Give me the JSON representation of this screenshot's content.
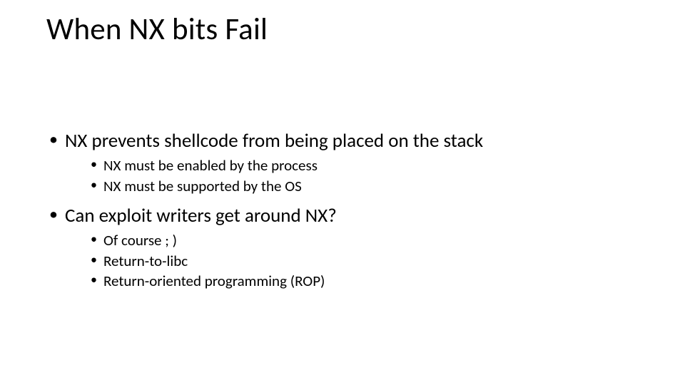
{
  "title": "When NX bits Fail",
  "bullets": [
    {
      "text": "NX prevents shellcode from being placed on the stack",
      "children": [
        {
          "text": "NX must be enabled by the process"
        },
        {
          "text": "NX must be supported by the OS"
        }
      ]
    },
    {
      "text": "Can exploit writers get around NX?",
      "children": [
        {
          "text": "Of course ; )"
        },
        {
          "text": "Return-to-libc"
        },
        {
          "text": "Return-oriented programming (ROP)"
        }
      ]
    }
  ]
}
